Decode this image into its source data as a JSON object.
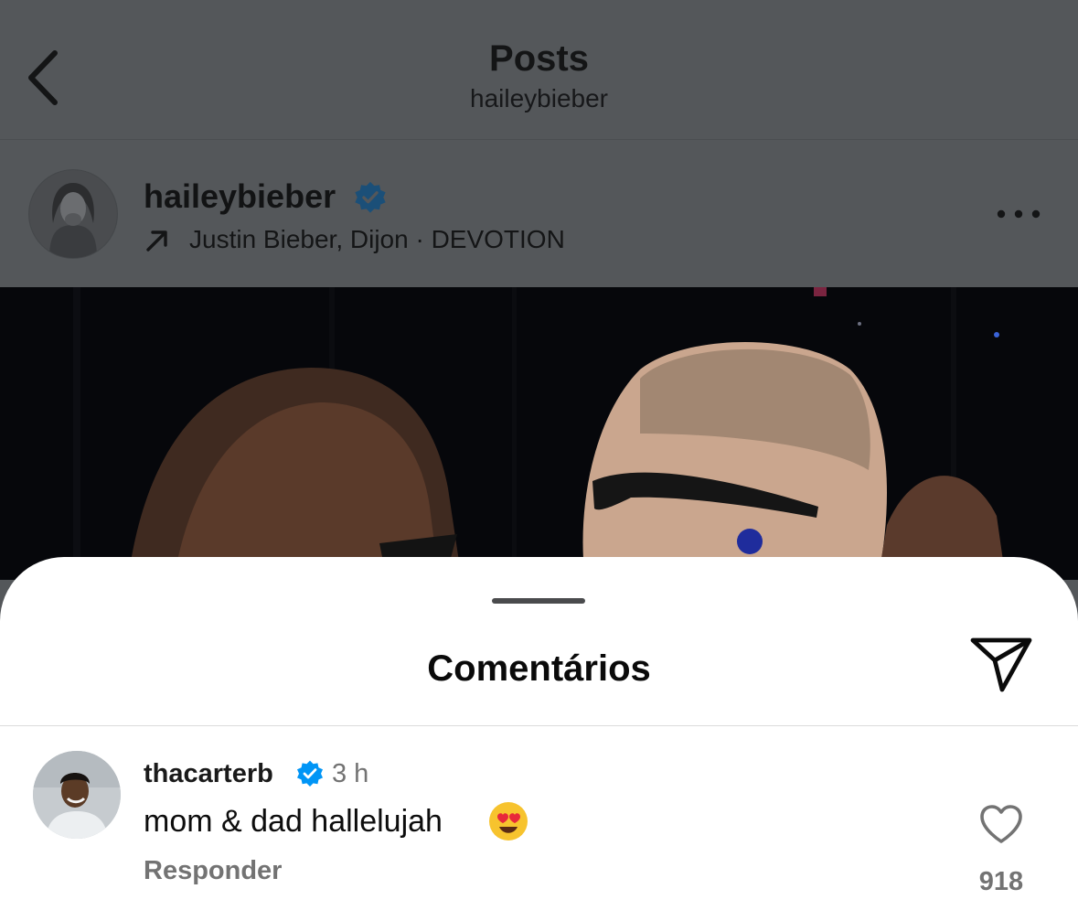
{
  "header": {
    "title": "Posts",
    "subtitle": "haileybieber"
  },
  "post": {
    "username": "haileybieber",
    "verified": true,
    "music": "Justin Bieber, Dijon · DEVOTION"
  },
  "comments_sheet": {
    "title": "Comentários",
    "comments": [
      {
        "username": "thacarterb",
        "verified": true,
        "time": "3 h",
        "text": "mom & dad hallelujah",
        "emoji": "heart-eyes-emoji",
        "reply_label": "Responder",
        "likes": "918"
      }
    ]
  },
  "colors": {
    "verified_blue": "#0095f6",
    "secondary_text": "#737373",
    "dim_overlay": "#54575a"
  }
}
